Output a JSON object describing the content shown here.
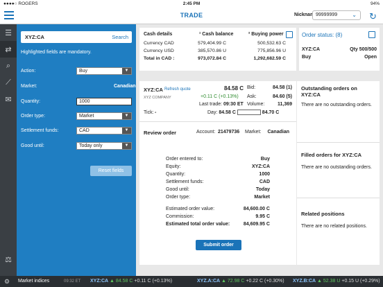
{
  "status_bar": {
    "carrier": "●●●●○ ROGERS",
    "time": "2:45 PM",
    "battery": "94%"
  },
  "nav": {
    "title": "TRADE",
    "nickname_label": "Nickname",
    "nickname_value": "99999999"
  },
  "order_form": {
    "symbol": "XYZ:CA",
    "search_label": "Search",
    "mandatory_note": "Highlighted fields are mandatory.",
    "action_label": "Action:",
    "action_value": "Buy",
    "market_label": "Market:",
    "market_value": "Canadian",
    "quantity_label": "Quantity:",
    "quantity_value": "1000",
    "order_type_label": "Order type:",
    "order_type_value": "Market",
    "settlement_label": "Settlement funds:",
    "settlement_value": "CAD",
    "good_until_label": "Good until:",
    "good_until_value": "Today only",
    "reset_label": "Reset fields"
  },
  "cash": {
    "h_details": "Cash details",
    "h_balance": "¹ Cash balance",
    "h_buying": "² Buying power",
    "rows": [
      {
        "label": "Currency CAD",
        "balance": "579,404.99 C",
        "buying": "500,532.63 C"
      },
      {
        "label": "Currency USD",
        "balance": "385,570.86 U",
        "buying": "775,856.96 U"
      },
      {
        "label": "Total in CAD :",
        "balance": "973,072.84 C",
        "buying": "1,292,682.59 C"
      }
    ]
  },
  "order_status": {
    "title": "Order status: (8)",
    "symbol": "XYZ:CA",
    "qty": "Qty 500/500",
    "action": "Buy",
    "state": "Open"
  },
  "quote": {
    "symbol": "XYZ:CA",
    "refresh": "Refresh quote",
    "company": "XYZ COMPANY",
    "price": "84.58 C",
    "change": "+0.11 C (+0.13%)",
    "last_trade_label": "Last trade:",
    "last_trade": "09:30 ET",
    "tick_label": "Tick:",
    "tick": "-",
    "bid_label": "Bid:",
    "bid": "84.58 (1)",
    "ask_label": "Ask:",
    "ask": "84.60 (5)",
    "volume_label": "Volume:",
    "volume": "11,369",
    "day_label": "Day:",
    "day_low": "84.58 C",
    "day_high": "84.70 C"
  },
  "review": {
    "title": "Review order",
    "account_label": "Account:",
    "account": "21479736",
    "market_label": "Market:",
    "market": "Canadian",
    "rows": [
      {
        "k": "Order entered to:",
        "v": "Buy"
      },
      {
        "k": "Equity:",
        "v": "XYZ:CA"
      },
      {
        "k": "Quantity:",
        "v": "1000"
      },
      {
        "k": "Settlement funds:",
        "v": "CAD"
      },
      {
        "k": "Good until:",
        "v": "Today"
      },
      {
        "k": "Order type:",
        "v": "Market"
      }
    ],
    "est_value_label": "Estimated order value:",
    "est_value": "84,600.00 C",
    "commission_label": "Commission:",
    "commission": "9.95 C",
    "est_total_label": "Estimated total order value:",
    "est_total": "84,609.95 C",
    "submit_label": "Submit order"
  },
  "side": {
    "outstanding_title": "Outstanding orders on XYZ:CA",
    "outstanding_body": "There are no outstanding orders.",
    "filled_title": "Filled orders for XYZ:CA",
    "filled_body": "There are no outstanding orders.",
    "related_title": "Related positions",
    "related_body": "There are no related positions."
  },
  "ticker": {
    "market_label": "Market indices",
    "time": "09:32 ET",
    "items": [
      {
        "sym": "XYZ:CA",
        "price": "▲ 84.58 C",
        "chg": "+0.11 C (+0.13%)"
      },
      {
        "sym": "XYZ.A:CA",
        "price": "▲ 72.98 C",
        "chg": "+0.22 C (+0.30%)"
      },
      {
        "sym": "XYZ.B:CA",
        "price": "▲ 52.38 U",
        "chg": "+0.15 U (+0.29%)"
      }
    ]
  },
  "colors": {
    "accent": "#1a73b8",
    "order_panel": "#1f7ec2",
    "positive": "#2e8b2e"
  }
}
